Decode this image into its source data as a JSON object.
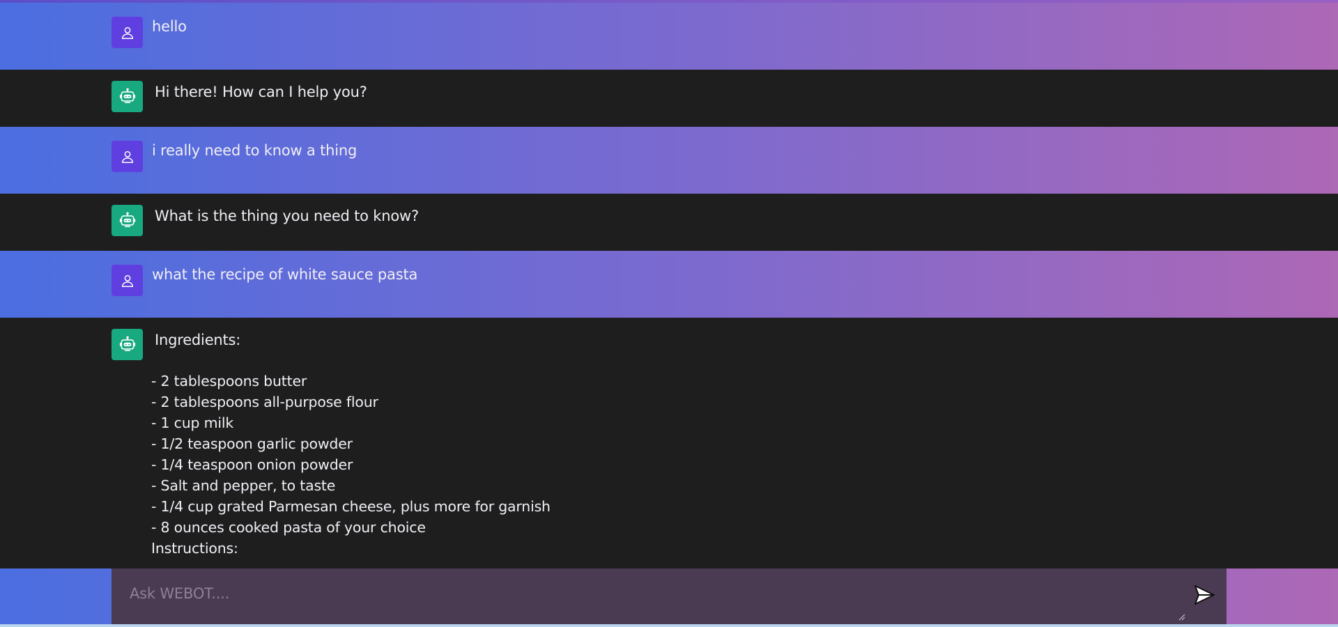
{
  "app": {
    "name": "WEBOT"
  },
  "colors": {
    "user_row_gradient_start": "#4b6ee0",
    "user_row_gradient_end": "#ad68b6",
    "bot_row_background": "#1e1e1e",
    "user_avatar": "#5f3fe0",
    "bot_avatar": "#18a980",
    "input_background": "#4a3a52"
  },
  "conversation": {
    "messages": [
      {
        "role": "user",
        "icon": "user-icon",
        "text": "hello"
      },
      {
        "role": "bot",
        "icon": "robot-icon",
        "text": "Hi there! How can I help you?"
      },
      {
        "role": "user",
        "icon": "user-icon",
        "text": "i really need to know a thing"
      },
      {
        "role": "bot",
        "icon": "robot-icon",
        "text": "What is the thing you need to know?"
      },
      {
        "role": "user",
        "icon": "user-icon",
        "text": "what the recipe of white sauce pasta"
      },
      {
        "role": "bot",
        "icon": "robot-icon",
        "text": "Ingredients:",
        "lines": [
          "- 2 tablespoons butter",
          "- 2 tablespoons all-purpose flour",
          "- 1 cup milk",
          "- 1/2 teaspoon garlic powder",
          "- 1/4 teaspoon onion powder",
          "- Salt and pepper, to taste",
          "- 1/4 cup grated Parmesan cheese, plus more for garnish",
          "- 8 ounces cooked pasta of your choice",
          "Instructions:"
        ]
      }
    ]
  },
  "composer": {
    "placeholder": "Ask WEBOT....",
    "value": "",
    "send_icon": "send-icon"
  }
}
